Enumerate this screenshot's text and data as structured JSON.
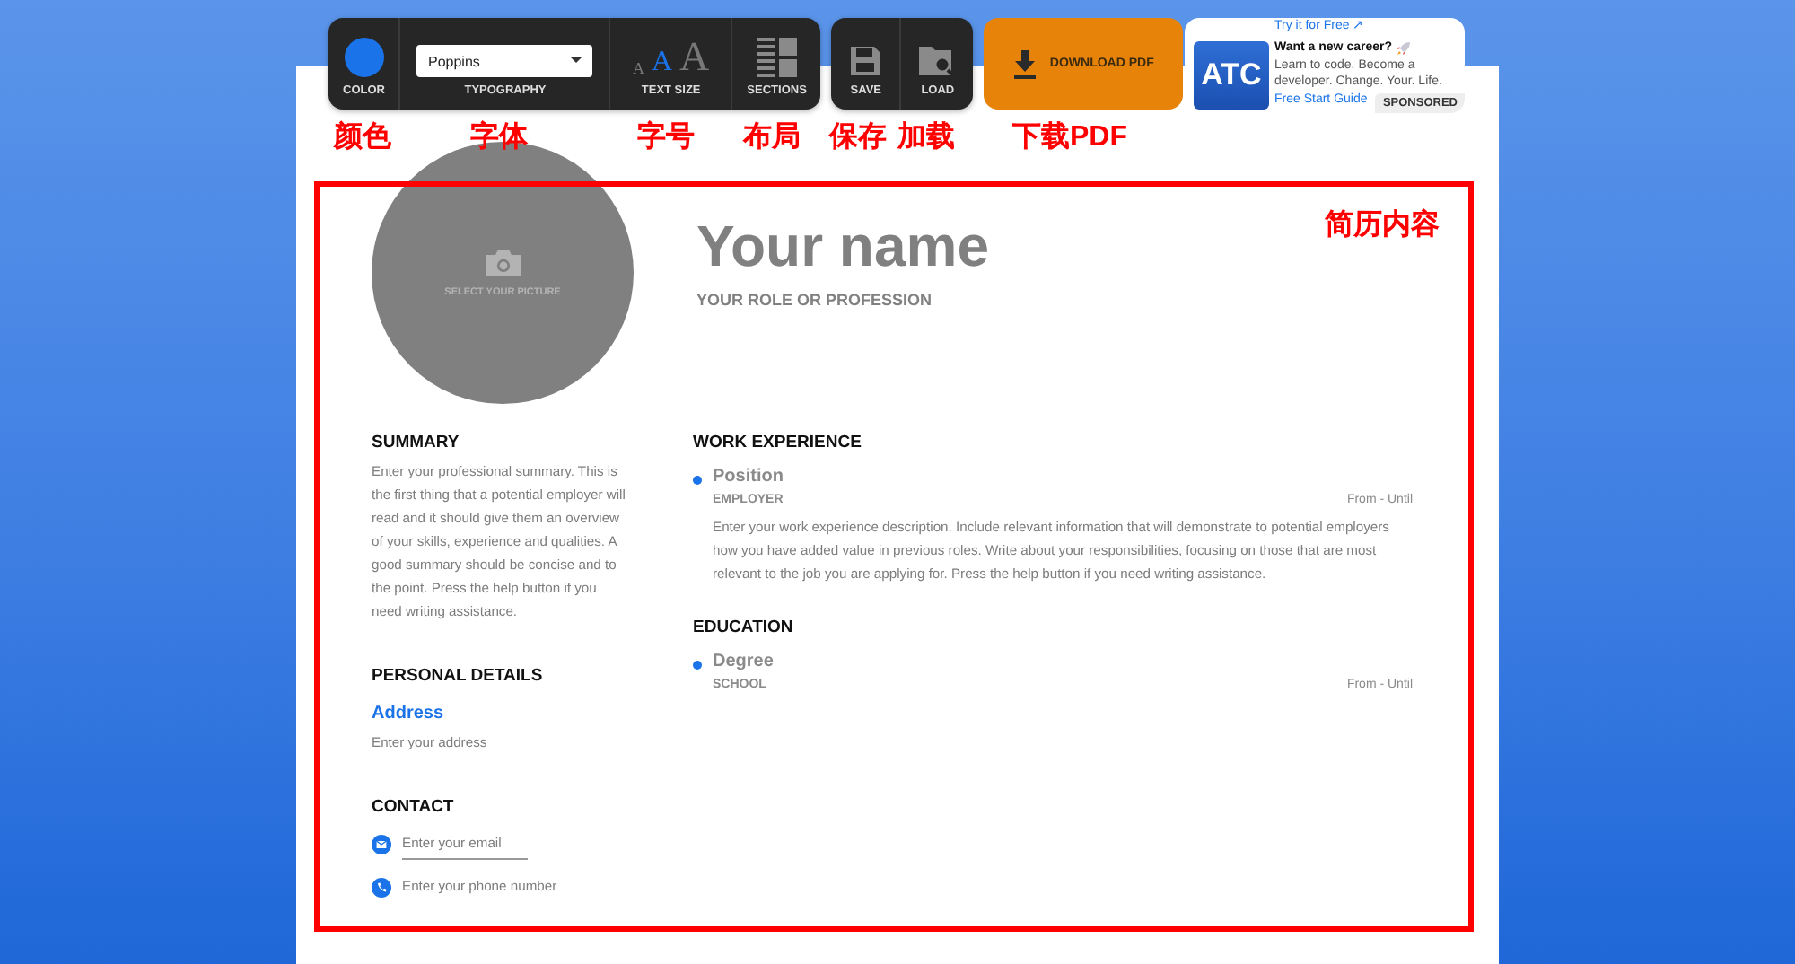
{
  "toolbar": {
    "color": {
      "label": "COLOR",
      "color": "#1a73e8"
    },
    "typography": {
      "value": "Poppins",
      "label": "TYPOGRAPHY"
    },
    "text_size": {
      "label": "TEXT SIZE",
      "options": [
        {
          "glyph": "A",
          "selected": false
        },
        {
          "glyph": "A",
          "selected": true
        },
        {
          "glyph": "A",
          "selected": false
        }
      ]
    },
    "sections": {
      "label": "SECTIONS"
    },
    "save": {
      "label": "SAVE"
    },
    "load": {
      "label": "LOAD"
    },
    "download": {
      "label": "DOWNLOAD PDF"
    }
  },
  "ad": {
    "top_link": "Try it for Free ↗",
    "logo": "ATC",
    "title": "Want a new career?",
    "body": "Learn to code. Become a developer. Change. Your. Life.",
    "link": "Free Start Guide",
    "badge": "SPONSORED"
  },
  "annotations": [
    {
      "text": "颜色"
    },
    {
      "text": "字体"
    },
    {
      "text": "字号"
    },
    {
      "text": "布局"
    },
    {
      "text": "保存"
    },
    {
      "text": "加载"
    },
    {
      "text": "下载PDF"
    },
    {
      "text": "简历内容"
    }
  ],
  "resume": {
    "photo_label": "SELECT YOUR PICTURE",
    "name": "Your name",
    "role": "YOUR ROLE OR PROFESSION",
    "summary": {
      "heading": "SUMMARY",
      "text": "Enter your professional summary. This is the first thing that a potential employer will read and it should give them an overview of your skills, experience and qualities. A good summary should be concise and to the point. Press the help button if you need writing assistance."
    },
    "personal": {
      "heading": "PERSONAL DETAILS",
      "label": "Address",
      "placeholder": "Enter your address"
    },
    "contact": {
      "heading": "CONTACT",
      "items": [
        {
          "kind": "email",
          "placeholder": "Enter your email",
          "focused": true
        },
        {
          "kind": "phone",
          "placeholder": "Enter your phone number",
          "focused": false
        }
      ]
    },
    "sections": [
      {
        "heading": "WORK EXPERIENCE",
        "title": "Position",
        "subtitle": "EMPLOYER",
        "dates": "From - Until",
        "description": "Enter your work experience description. Include relevant information that will demonstrate to potential employers how you have added value in previous roles. Write about your responsibilities, focusing on those that are most relevant to the job you are applying for. Press the help button if you need writing assistance."
      },
      {
        "heading": "EDUCATION",
        "title": "Degree",
        "subtitle": "SCHOOL",
        "dates": "From - Until"
      }
    ]
  }
}
